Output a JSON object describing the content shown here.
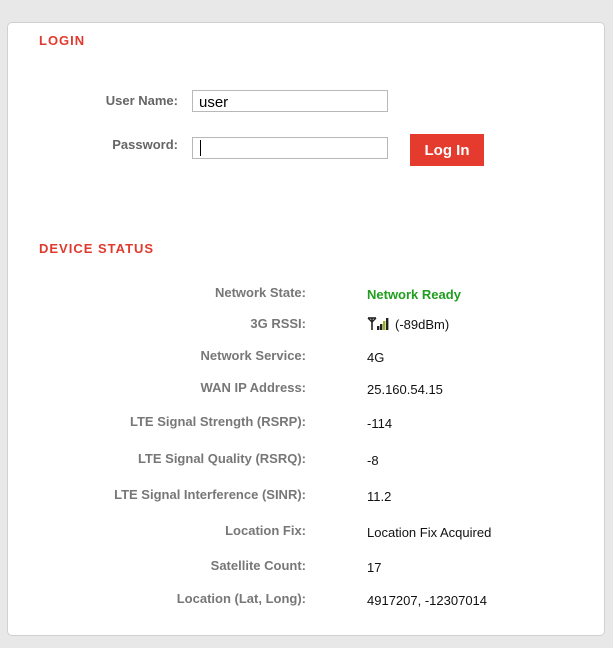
{
  "login": {
    "title": "LOGIN",
    "username_label": "User Name:",
    "username_value": "user",
    "password_label": "Password:",
    "password_value": "",
    "button_label": "Log In"
  },
  "device_status": {
    "title": "DEVICE STATUS",
    "rows": [
      {
        "label": "Network State:",
        "value": "Network Ready"
      },
      {
        "label": "3G RSSI:",
        "value": "(-89dBm)"
      },
      {
        "label": "Network Service:",
        "value": "4G"
      },
      {
        "label": "WAN IP Address:",
        "value": "25.160.54.15"
      },
      {
        "label": "LTE Signal Strength (RSRP):",
        "value": "-114"
      },
      {
        "label": "LTE Signal Quality (RSRQ):",
        "value": "-8"
      },
      {
        "label": "LTE Signal Interference (SINR):",
        "value": "11.2"
      },
      {
        "label": "Location Fix:",
        "value": "Location Fix Acquired"
      },
      {
        "label": "Satellite Count:",
        "value": "17"
      },
      {
        "label": "Location (Lat, Long):",
        "value": "4917207, -12307014"
      }
    ],
    "signal_icon": "signal-bars-icon"
  },
  "colors": {
    "accent": "#e03a2e",
    "button": "#e53b2f",
    "ready": "#1f9e1f",
    "label": "#777777"
  }
}
